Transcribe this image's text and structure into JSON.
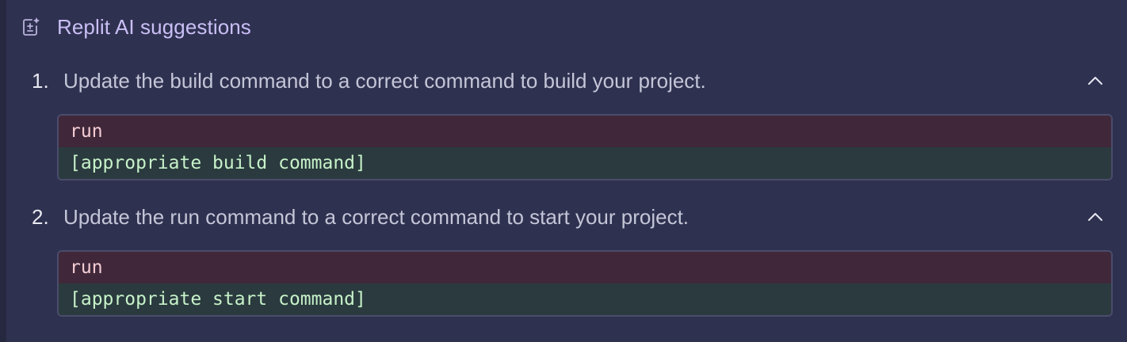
{
  "header": {
    "title": "Replit AI suggestions",
    "icon": "ai-suggestion-icon"
  },
  "suggestions": [
    {
      "number": "1.",
      "text": "Update the build command to a correct command to build your project.",
      "expanded": true,
      "diff": {
        "removed": "run",
        "added": "[appropriate build command]"
      }
    },
    {
      "number": "2.",
      "text": "Update the run command to a correct command to start your project.",
      "expanded": true,
      "diff": {
        "removed": "run",
        "added": "[appropriate start command]"
      }
    }
  ],
  "colors": {
    "background": "#2f3150",
    "title": "#c9bff5",
    "removed_bg": "#40283a",
    "added_bg": "#2a3a3e"
  }
}
